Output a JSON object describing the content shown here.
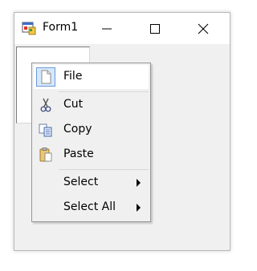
{
  "window": {
    "title": "Form1",
    "app_icon": "winforms-app-icon",
    "minimize_icon": "minimize-icon",
    "maximize_icon": "maximize-icon",
    "close_icon": "close-icon"
  },
  "context_menu": {
    "items": [
      {
        "label": "File",
        "icon": "document-icon",
        "selected": true
      },
      {
        "label": "Cut",
        "icon": "scissors-icon"
      },
      {
        "label": "Copy",
        "icon": "copy-icon"
      },
      {
        "label": "Paste",
        "icon": "clipboard-icon"
      },
      {
        "label": "Select",
        "icon": "",
        "submenu": true
      },
      {
        "label": "Select All",
        "icon": "",
        "submenu": true
      }
    ]
  }
}
